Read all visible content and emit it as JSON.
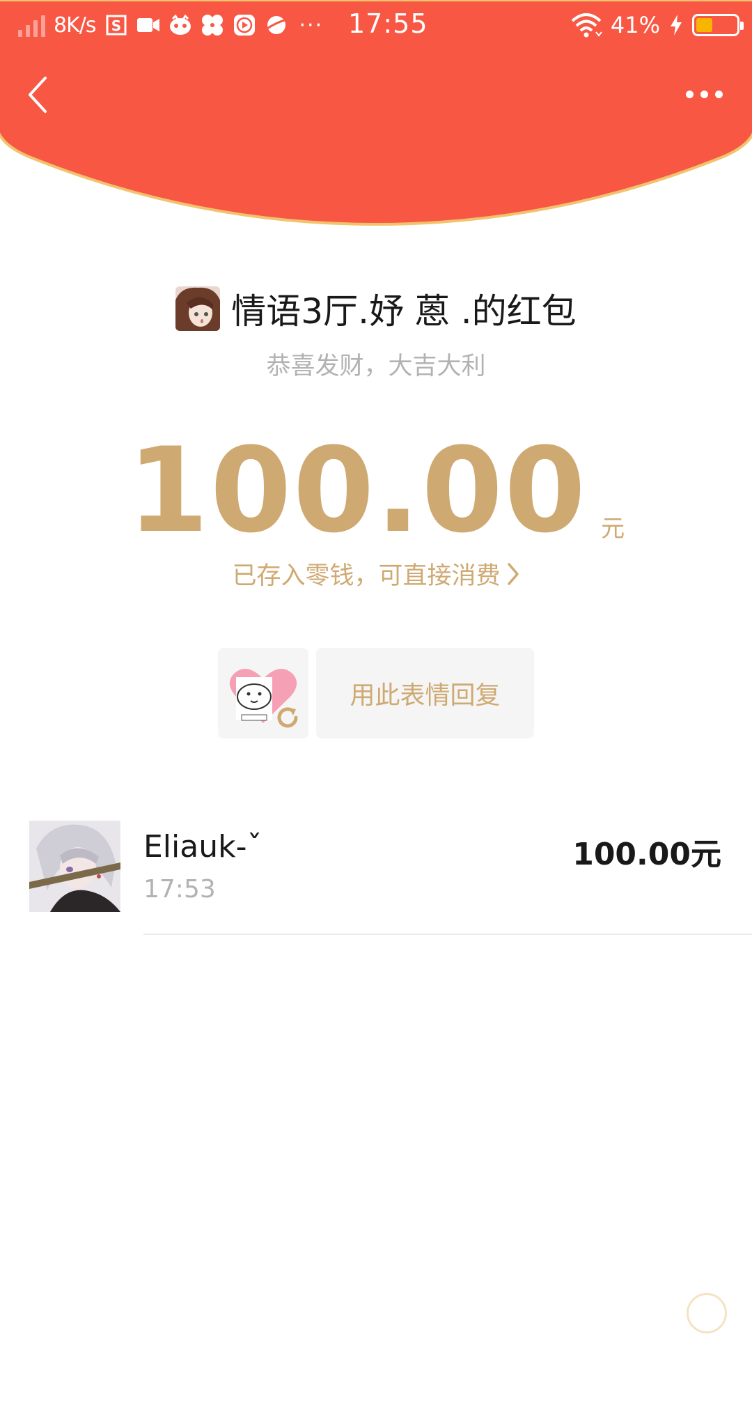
{
  "colors": {
    "header_red": "#f85744",
    "header_edge": "#f2c36d",
    "gold": "#cfa972",
    "gray_text": "#b2b2b2",
    "battery_fill": "#f7b500"
  },
  "status_bar": {
    "network_speed": "8K/s",
    "time": "17:55",
    "battery_percent": "41%",
    "battery_level": 0.41,
    "app_icons": [
      "screenshot-icon",
      "video-camera-icon",
      "app-face-icon",
      "pinwheel-icon",
      "play-icon",
      "planet-icon"
    ],
    "more_indicator": "···"
  },
  "nav": {
    "back_icon": "chevron-left-icon",
    "more_icon": "more-dots-icon"
  },
  "red_packet": {
    "sender_title": "情语3厅.妤 蒽 .的红包",
    "greeting": "恭喜发财，大吉大利",
    "amount": "100.00",
    "amount_unit": "元",
    "saved_note": "已存入零钱，可直接消费",
    "saved_note_icon": "chevron-right-icon",
    "reply_label": "用此表情回复",
    "sticker_refresh_icon": "refresh-icon"
  },
  "receivers": [
    {
      "name": "Eliauk-ˇ",
      "time": "17:53",
      "amount": "100.00元"
    }
  ]
}
